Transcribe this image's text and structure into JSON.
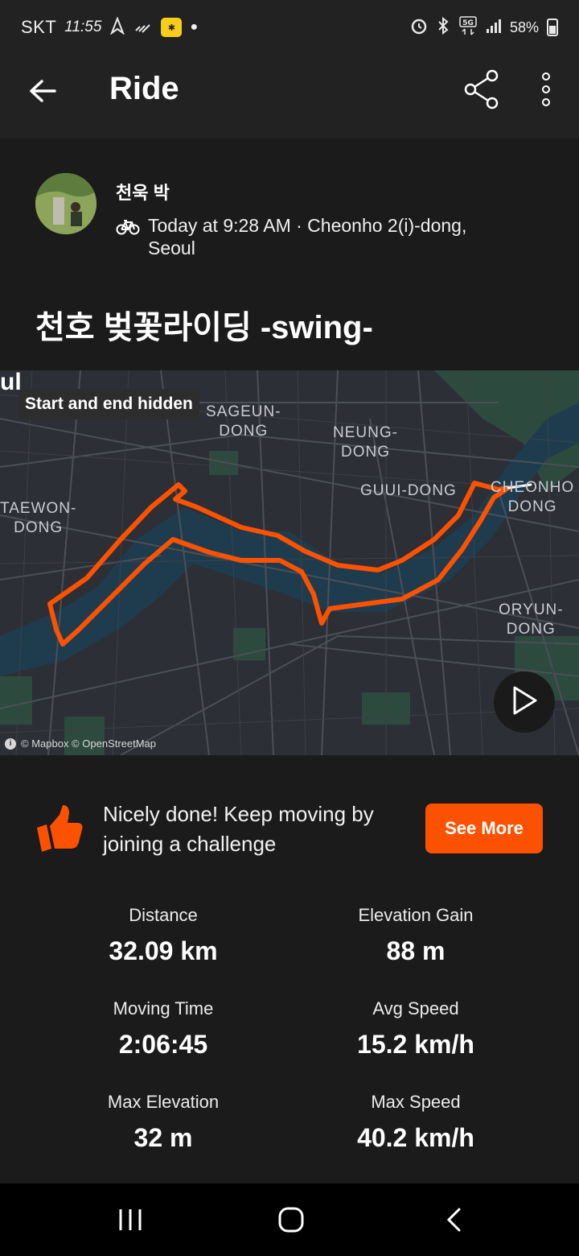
{
  "status_bar": {
    "carrier": "SKT",
    "time": "11:55",
    "battery": "58%",
    "icons": [
      "navigation-icon",
      "wifi-calling-icon",
      "kakao-icon",
      "dot-icon",
      "alarm-icon",
      "bluetooth-icon",
      "5g-icon",
      "signal-icon",
      "battery-icon"
    ]
  },
  "app_bar": {
    "title": "Ride",
    "icons": [
      "back-arrow-icon",
      "share-icon",
      "more-vertical-icon"
    ]
  },
  "header": {
    "athlete_name": "천욱 박",
    "activity_type_icon": "bike-icon",
    "meta": "Today at 9:28 AM · Cheonho 2(i)-dong, Seoul"
  },
  "activity": {
    "name": "천호 벚꽃라이딩 -swing-"
  },
  "map": {
    "fragment_label": "ul",
    "privacy_badge": "Start and end hidden",
    "labels": {
      "sageun_dong": "SAGEUN-\nDONG",
      "neung_dong": "NEUNG-\nDONG",
      "guui_dong": "GUUI-DONG",
      "cheonho_dong": "CHEONHO\nDONG",
      "taewon_dong": "TAEWON-\nDONG",
      "oryun_dong": "ORYUN-\nDONG"
    },
    "attribution": "© Mapbox © OpenStreetMap",
    "route_color": "#fc5200",
    "play_icon": "play-icon"
  },
  "challenge": {
    "icon": "thumbs-up-icon",
    "text": "Nicely done! Keep moving by joining a challenge",
    "button_label": "See More",
    "accent": "#fc5200"
  },
  "stats": {
    "distance": {
      "label": "Distance",
      "value": "32.09 km"
    },
    "elevation_gain": {
      "label": "Elevation Gain",
      "value": "88 m"
    },
    "moving_time": {
      "label": "Moving Time",
      "value": "2:06:45"
    },
    "avg_speed": {
      "label": "Avg Speed",
      "value": "15.2 km/h"
    },
    "max_elevation": {
      "label": "Max Elevation",
      "value": "32 m"
    },
    "max_speed": {
      "label": "Max Speed",
      "value": "40.2 km/h"
    }
  },
  "nav_bar": {
    "icons": [
      "recents-icon",
      "home-icon",
      "back-icon"
    ]
  }
}
